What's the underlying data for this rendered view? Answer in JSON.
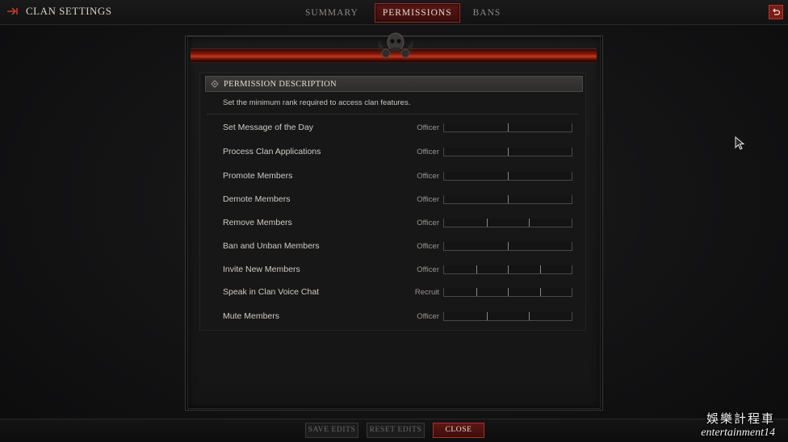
{
  "header": {
    "title": "CLAN SETTINGS",
    "back_icon": "back-arrow-icon",
    "corner_icon": "return-icon"
  },
  "tabs": [
    {
      "label": "SUMMARY",
      "active": false
    },
    {
      "label": "PERMISSIONS",
      "active": true
    },
    {
      "label": "BANS",
      "active": false
    }
  ],
  "permissions": {
    "header": "PERMISSION DESCRIPTION",
    "description": "Set the minimum rank required to access clan features.",
    "rows": [
      {
        "label": "Set Message of the Day",
        "rank": "Officer",
        "levels": 2
      },
      {
        "label": "Process Clan Applications",
        "rank": "Officer",
        "levels": 2
      },
      {
        "label": "Promote Members",
        "rank": "Officer",
        "levels": 2
      },
      {
        "label": "Demote Members",
        "rank": "Officer",
        "levels": 2
      },
      {
        "label": "Remove Members",
        "rank": "Officer",
        "levels": 3
      },
      {
        "label": "Ban and Unban Members",
        "rank": "Officer",
        "levels": 2
      },
      {
        "label": "Invite New Members",
        "rank": "Officer",
        "levels": 4
      },
      {
        "label": "Speak in Clan Voice Chat",
        "rank": "Recruit",
        "levels": 4
      },
      {
        "label": "Mute Members",
        "rank": "Officer",
        "levels": 3
      }
    ]
  },
  "footer": {
    "save_label": "SAVE EDITS",
    "reset_label": "RESET EDITS",
    "close_label": "CLOSE"
  },
  "watermark": {
    "line1": "娛樂計程車",
    "line2": "entertainment14"
  },
  "colors": {
    "accent_red": "#9a2a24",
    "background": "#111112",
    "text": "#cfcac2"
  }
}
